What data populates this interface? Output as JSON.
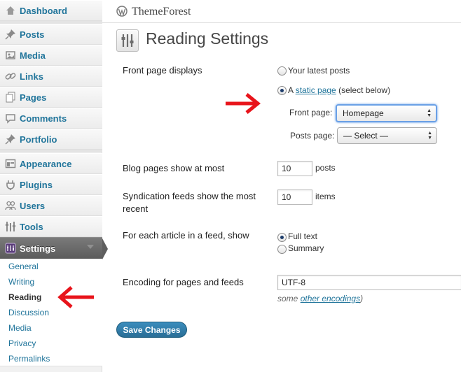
{
  "sidebar": {
    "items": [
      {
        "label": "Dashboard",
        "icon": "dashboard-icon"
      },
      {
        "label": "Posts",
        "icon": "pushpin-icon"
      },
      {
        "label": "Media",
        "icon": "media-icon"
      },
      {
        "label": "Links",
        "icon": "link-icon"
      },
      {
        "label": "Pages",
        "icon": "pages-icon"
      },
      {
        "label": "Comments",
        "icon": "comment-icon"
      },
      {
        "label": "Portfolio",
        "icon": "pushpin-icon"
      },
      {
        "label": "Appearance",
        "icon": "appearance-icon"
      },
      {
        "label": "Plugins",
        "icon": "plug-icon"
      },
      {
        "label": "Users",
        "icon": "users-icon"
      },
      {
        "label": "Tools",
        "icon": "tools-icon"
      },
      {
        "label": "Settings",
        "icon": "settings-icon"
      }
    ],
    "submenu": [
      "General",
      "Writing",
      "Reading",
      "Discussion",
      "Media",
      "Privacy",
      "Permalinks"
    ],
    "current_submenu": "Reading"
  },
  "header": {
    "site_name": "ThemeForest",
    "page_title": "Reading Settings"
  },
  "form": {
    "front_page": {
      "label": "Front page displays",
      "option_latest": "Your latest posts",
      "option_static_prefix": "A ",
      "option_static_link": "static page",
      "option_static_suffix": " (select below)",
      "selected": "static",
      "front_page_label": "Front page:",
      "front_page_value": "Homepage",
      "posts_page_label": "Posts page:",
      "posts_page_value": "— Select —"
    },
    "blog_pages": {
      "label": "Blog pages show at most",
      "value": "10",
      "unit": "posts"
    },
    "syndication": {
      "label": "Syndication feeds show the most recent",
      "value": "10",
      "unit": "items"
    },
    "feed_article": {
      "label": "For each article in a feed, show",
      "option_full": "Full text",
      "option_summary": "Summary",
      "selected": "full"
    },
    "encoding": {
      "label": "Encoding for pages and feeds",
      "value": "UTF-8",
      "help_prefix": "some ",
      "help_link": "other encodings",
      "help_suffix": ")"
    }
  },
  "buttons": {
    "save": "Save Changes"
  },
  "colors": {
    "link": "#21759b",
    "annotation_arrow": "#e8141b",
    "primary_button": "#2e7aa8"
  }
}
